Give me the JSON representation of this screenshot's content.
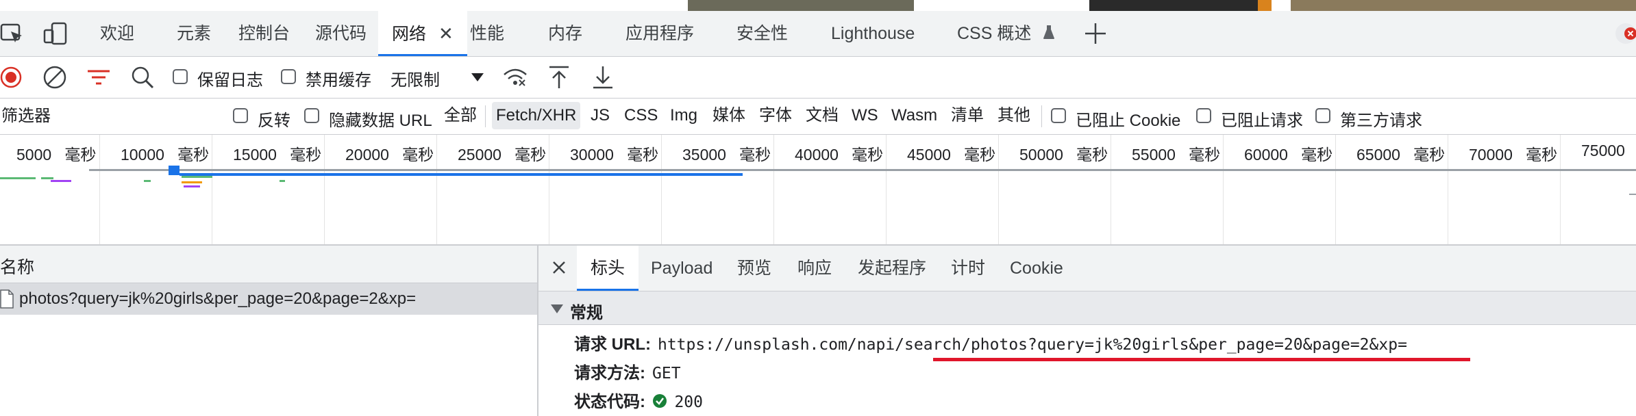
{
  "colors": {
    "accent": "#1a73e8",
    "record_red": "#d93025",
    "filter_red": "#d93025",
    "annotation_red": "#e0162b",
    "status_ok": "#188038",
    "panel_bg": "#f1f3f4"
  },
  "tabs": [
    {
      "label": "欢迎",
      "icon": "none"
    },
    {
      "label": "元素",
      "icon": "none"
    },
    {
      "label": "控制台",
      "icon": "none"
    },
    {
      "label": "源代码",
      "icon": "none"
    },
    {
      "label": "网络",
      "icon": "close-icon",
      "active": true
    },
    {
      "label": "性能",
      "icon": "none"
    },
    {
      "label": "内存",
      "icon": "none"
    },
    {
      "label": "应用程序",
      "icon": "none"
    },
    {
      "label": "安全性",
      "icon": "none"
    },
    {
      "label": "Lighthouse",
      "icon": "none"
    },
    {
      "label": "CSS 概述",
      "icon": "flask-icon"
    }
  ],
  "toolbar": {
    "preserve_log": "保留日志",
    "disable_cache": "禁用缓存",
    "throttling": "无限制"
  },
  "filter": {
    "placeholder": "筛选器",
    "invert": "反转",
    "hide_data_urls": "隐藏数据 URL",
    "types": [
      "全部",
      "Fetch/XHR",
      "JS",
      "CSS",
      "Img",
      "媒体",
      "字体",
      "文档",
      "WS",
      "Wasm",
      "清单",
      "其他"
    ],
    "active_type": "Fetch/XHR",
    "blocked_cookies": "已阻止 Cookie",
    "blocked_requests": "已阻止请求",
    "third_party": "第三方请求"
  },
  "timeline": {
    "unit": "毫秒",
    "ticks": [
      "5000",
      "10000",
      "15000",
      "20000",
      "25000",
      "30000",
      "35000",
      "40000",
      "45000",
      "50000",
      "55000",
      "60000",
      "65000",
      "70000",
      "75000"
    ]
  },
  "request_list": {
    "header": "名称",
    "rows": [
      {
        "name": "photos?query=jk%20girls&per_page=20&page=2&xp="
      }
    ]
  },
  "details": {
    "tabs": [
      "标头",
      "Payload",
      "预览",
      "响应",
      "发起程序",
      "计时",
      "Cookie"
    ],
    "active_tab": "标头",
    "section": "常规",
    "general": {
      "url_label": "请求 URL:",
      "url_value": "https://unsplash.com/napi/search/photos?query=jk%20girls&per_page=20&page=2&xp=",
      "method_label": "请求方法:",
      "method_value": "GET",
      "status_label": "状态代码:",
      "status_value": "200"
    }
  }
}
